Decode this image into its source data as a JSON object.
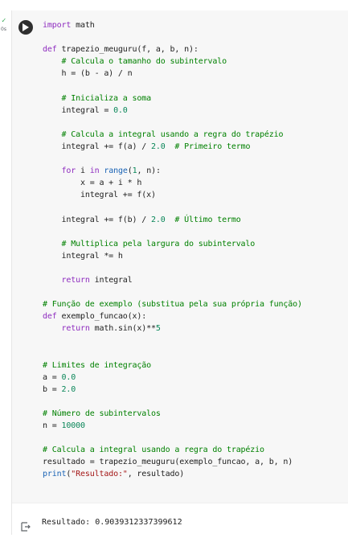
{
  "status": {
    "check_icon": "check-icon",
    "time": "0s"
  },
  "cell": {
    "run_icon": "play-icon",
    "code_lines": [
      [
        {
          "t": "import",
          "c": "kw"
        },
        {
          "t": " math",
          "c": "p"
        }
      ],
      [],
      [
        {
          "t": "def",
          "c": "kw"
        },
        {
          "t": " trapezio_meuguru(f, a, b, n):",
          "c": "p"
        }
      ],
      [
        {
          "t": "    # Calcula o tamanho do subintervalo",
          "c": "cmt"
        }
      ],
      [
        {
          "t": "    h = (b - a) / n",
          "c": "p"
        }
      ],
      [],
      [
        {
          "t": "    # Inicializa a soma",
          "c": "cmt"
        }
      ],
      [
        {
          "t": "    integral = ",
          "c": "p"
        },
        {
          "t": "0.0",
          "c": "num"
        }
      ],
      [],
      [
        {
          "t": "    # Calcula a integral usando a regra do trapézio",
          "c": "cmt"
        }
      ],
      [
        {
          "t": "    integral += f(a) / ",
          "c": "p"
        },
        {
          "t": "2.0",
          "c": "num"
        },
        {
          "t": "  ",
          "c": "p"
        },
        {
          "t": "# Primeiro termo",
          "c": "cmt"
        }
      ],
      [],
      [
        {
          "t": "    ",
          "c": "p"
        },
        {
          "t": "for",
          "c": "kw"
        },
        {
          "t": " i ",
          "c": "p"
        },
        {
          "t": "in",
          "c": "kw"
        },
        {
          "t": " ",
          "c": "p"
        },
        {
          "t": "range",
          "c": "bi"
        },
        {
          "t": "(",
          "c": "p"
        },
        {
          "t": "1",
          "c": "num"
        },
        {
          "t": ", n):",
          "c": "p"
        }
      ],
      [
        {
          "t": "        x = a + i * h",
          "c": "p"
        }
      ],
      [
        {
          "t": "        integral += f(x)",
          "c": "p"
        }
      ],
      [],
      [
        {
          "t": "    integral += f(b) / ",
          "c": "p"
        },
        {
          "t": "2.0",
          "c": "num"
        },
        {
          "t": "  ",
          "c": "p"
        },
        {
          "t": "# Último termo",
          "c": "cmt"
        }
      ],
      [],
      [
        {
          "t": "    # Multiplica pela largura do subintervalo",
          "c": "cmt"
        }
      ],
      [
        {
          "t": "    integral *= h",
          "c": "p"
        }
      ],
      [],
      [
        {
          "t": "    ",
          "c": "p"
        },
        {
          "t": "return",
          "c": "kw"
        },
        {
          "t": " integral",
          "c": "p"
        }
      ],
      [],
      [
        {
          "t": "# Função de exemplo (substitua pela sua própria função)",
          "c": "cmt"
        }
      ],
      [
        {
          "t": "def",
          "c": "kw"
        },
        {
          "t": " exemplo_funcao(x):",
          "c": "p"
        }
      ],
      [
        {
          "t": "    ",
          "c": "p"
        },
        {
          "t": "return",
          "c": "kw"
        },
        {
          "t": " math.sin(x)**",
          "c": "p"
        },
        {
          "t": "5",
          "c": "num"
        }
      ],
      [],
      [],
      [
        {
          "t": "# Limites de integração",
          "c": "cmt"
        }
      ],
      [
        {
          "t": "a = ",
          "c": "p"
        },
        {
          "t": "0.0",
          "c": "num"
        }
      ],
      [
        {
          "t": "b = ",
          "c": "p"
        },
        {
          "t": "2.0",
          "c": "num"
        }
      ],
      [],
      [
        {
          "t": "# Número de subintervalos",
          "c": "cmt"
        }
      ],
      [
        {
          "t": "n = ",
          "c": "p"
        },
        {
          "t": "10000",
          "c": "num"
        }
      ],
      [],
      [
        {
          "t": "# Calcula a integral usando a regra do trapézio",
          "c": "cmt"
        }
      ],
      [
        {
          "t": "resultado = trapezio_meuguru(exemplo_funcao, a, b, n)",
          "c": "p"
        }
      ],
      [
        {
          "t": "print",
          "c": "bi"
        },
        {
          "t": "(",
          "c": "p"
        },
        {
          "t": "\"Resultado:\"",
          "c": "str"
        },
        {
          "t": ", resultado)",
          "c": "p"
        }
      ]
    ]
  },
  "output": {
    "icon": "output-redirect-icon",
    "text": "Resultado: 0.9039312337399612"
  },
  "colors": {
    "keyword": "#8e2cbf",
    "comment": "#008000",
    "number": "#098658",
    "string": "#a31515",
    "builtin": "#1a63b5",
    "run_button": "#2f2f2f",
    "success": "#34a853"
  }
}
